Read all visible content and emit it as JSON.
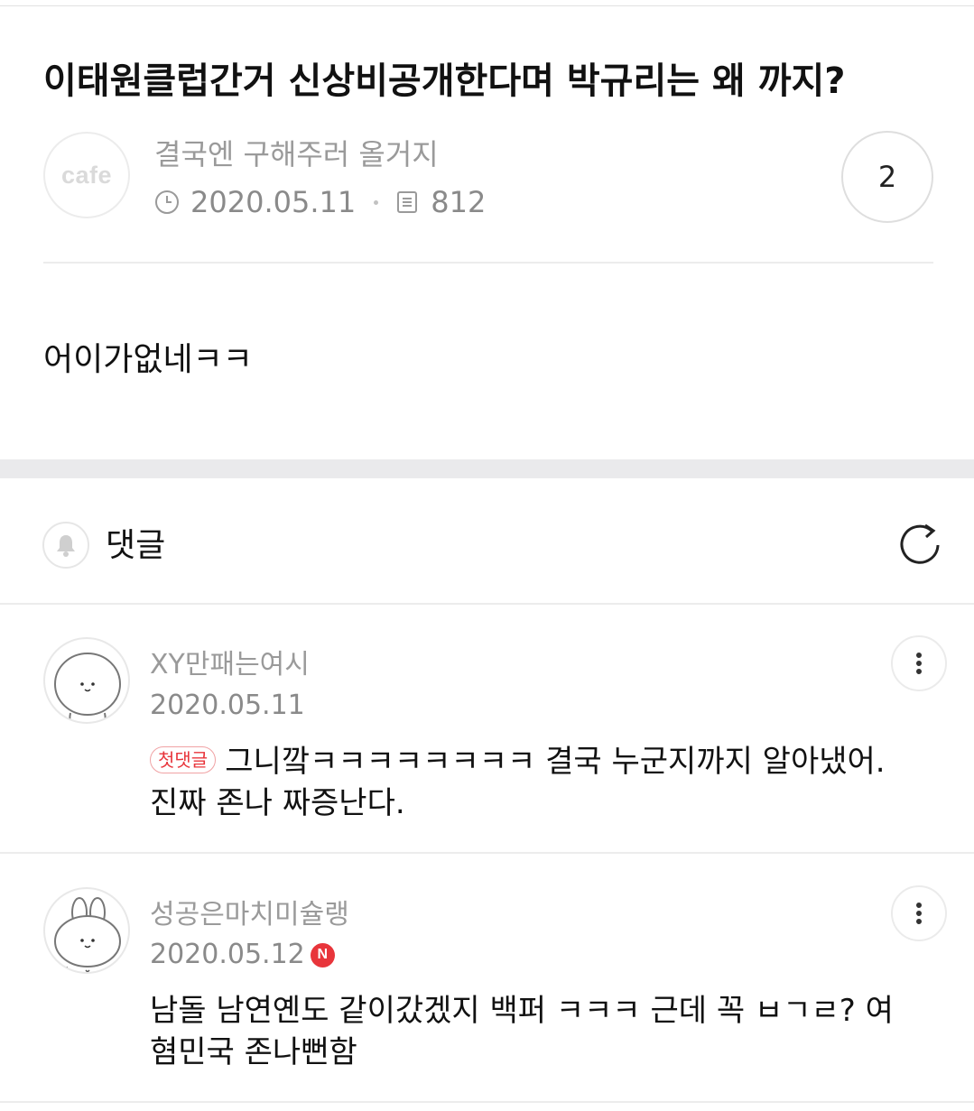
{
  "post": {
    "title": "이태원클럽간거 신상비공개한다며 박규리는 왜 까지?",
    "cafe_logo": "cafe",
    "author": "결국엔 구해주러 올거지",
    "date": "2020.05.11",
    "views": "812",
    "comment_count": "2",
    "body": "어이가없네ㅋㅋ"
  },
  "comments_section": {
    "label": "댓글"
  },
  "comments": [
    {
      "author": "XY만패는여시",
      "date": "2020.05.11",
      "badge": "첫댓글",
      "line1": "그니깤ㅋㅋㅋㅋㅋㅋㅋㅋ 결국 누군지까지 알아냈어.",
      "line2": "진짜 존나 짜증난다."
    },
    {
      "author": "성공은마치미슐랭",
      "date": "2020.05.12",
      "new_badge": "N",
      "line1": "남돌 남연옌도 같이갔겠지 백퍼 ㅋㅋㅋ 근데 꼭 ㅂㄱㄹ? 여",
      "line2": "혐민국 존나뻔함"
    }
  ],
  "icons": {
    "clock": "clock-icon",
    "views": "document-icon",
    "bell": "bell-icon",
    "refresh": "refresh-icon",
    "more": "more-vertical-icon"
  },
  "colors": {
    "accent_red": "#e8353b",
    "meta_gray": "#8a8a8a",
    "band_gray": "#eaeaec"
  }
}
